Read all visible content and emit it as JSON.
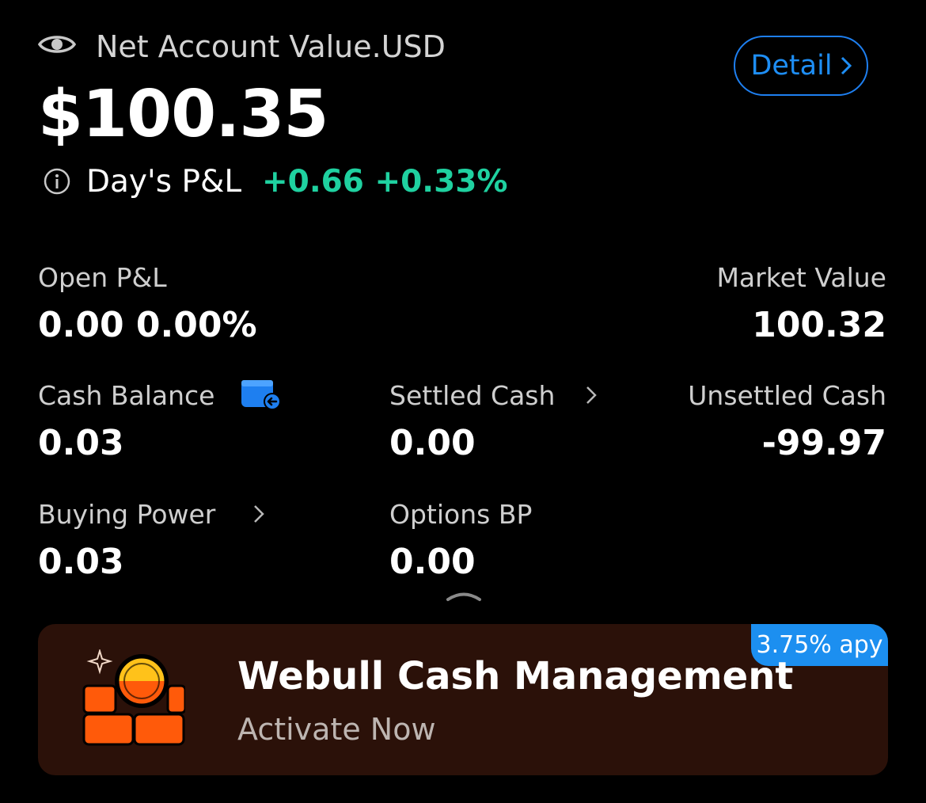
{
  "header": {
    "title": "Net Account Value.USD",
    "net_value": "$100.35",
    "pl_label": "Day's P&L",
    "pl_value": "+0.66 +0.33%",
    "detail_label": "Detail"
  },
  "metrics": {
    "open_pl": {
      "label": "Open P&L",
      "value": "0.00 0.00%"
    },
    "market_value": {
      "label": "Market Value",
      "value": "100.32"
    },
    "cash_balance": {
      "label": "Cash Balance",
      "value": "0.03"
    },
    "settled_cash": {
      "label": "Settled Cash",
      "value": "0.00"
    },
    "unsettled_cash": {
      "label": "Unsettled Cash",
      "value": "-99.97"
    },
    "buying_power": {
      "label": "Buying Power",
      "value": "0.03"
    },
    "options_bp": {
      "label": "Options BP",
      "value": "0.00"
    }
  },
  "banner": {
    "badge": "3.75% apy",
    "title": "Webull Cash Management",
    "subtitle": "Activate Now"
  },
  "colors": {
    "background": "#000000",
    "accent_blue": "#1e8ef5",
    "positive_green": "#1fd1a0",
    "banner_bg": "#2b1109",
    "banner_orange": "#ff5a0a",
    "coin_yellow": "#ffc21a"
  },
  "icons": {
    "eye": "eye-icon",
    "info": "info-icon",
    "detail_chevron": "chevron-right-icon",
    "cash_wallet": "wallet-transfer-icon",
    "collapse": "chevron-up-icon",
    "banner": "cash-vault-icon"
  }
}
